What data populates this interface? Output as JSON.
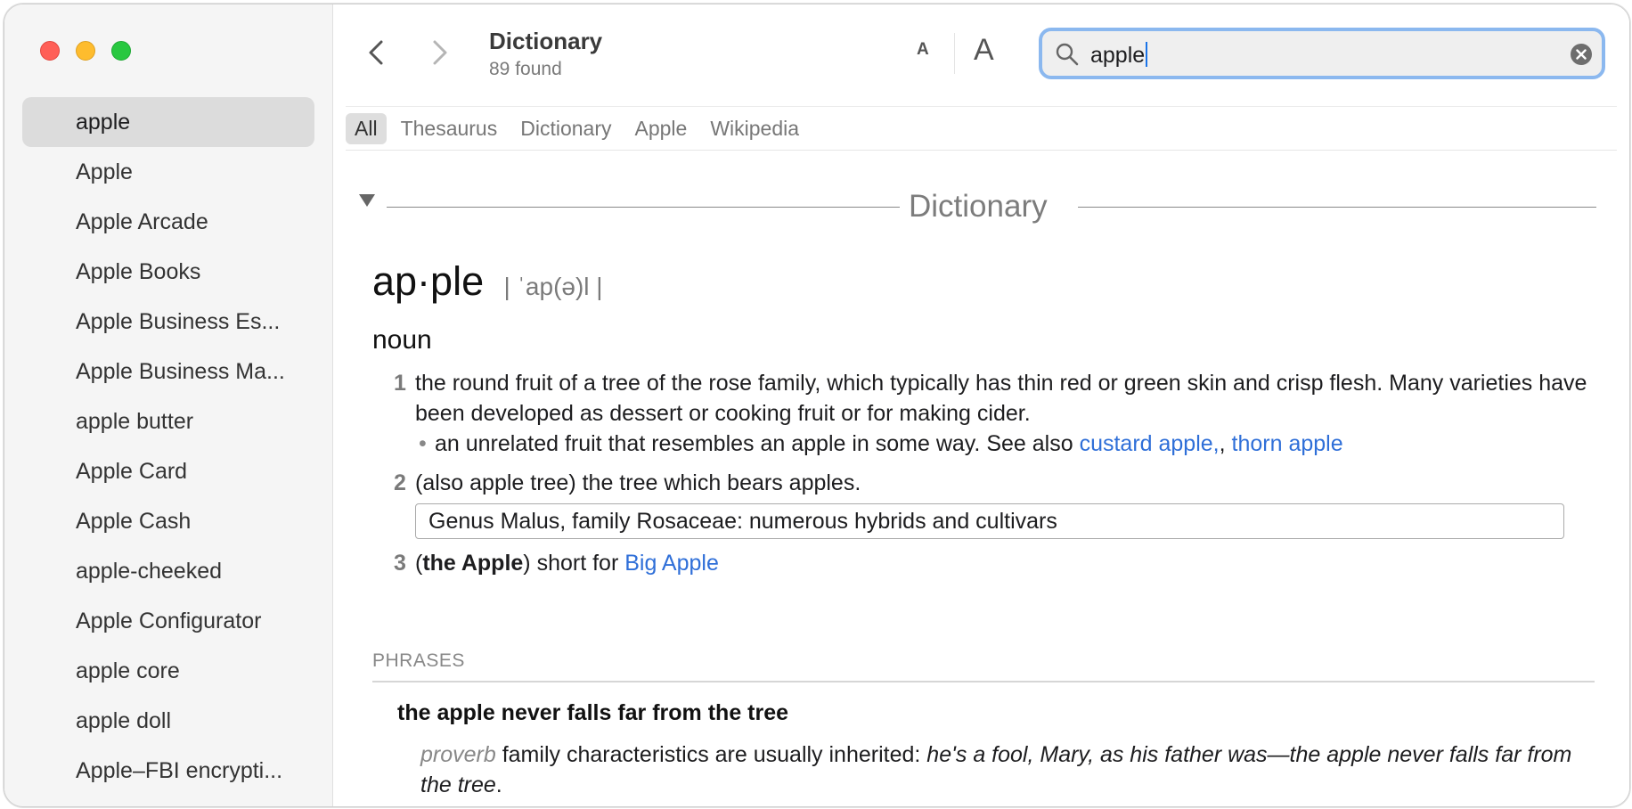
{
  "sidebar": {
    "items": [
      {
        "label": "apple",
        "selected": true
      },
      {
        "label": "Apple"
      },
      {
        "label": "Apple Arcade"
      },
      {
        "label": "Apple Books"
      },
      {
        "label": "Apple Business Es..."
      },
      {
        "label": "Apple Business Ma..."
      },
      {
        "label": "apple butter"
      },
      {
        "label": "Apple Card"
      },
      {
        "label": "Apple Cash"
      },
      {
        "label": "apple-cheeked"
      },
      {
        "label": "Apple Configurator"
      },
      {
        "label": "apple core"
      },
      {
        "label": "apple doll"
      },
      {
        "label": "Apple–FBI encrypti..."
      }
    ]
  },
  "toolbar": {
    "title": "Dictionary",
    "subtitle": "89 found",
    "font_small_label": "A",
    "font_large_label": "A",
    "search_value": "apple",
    "icons": [
      "back-chevron-icon",
      "forward-chevron-icon",
      "search-icon",
      "clear-icon"
    ]
  },
  "tabs": [
    "All",
    "Thesaurus",
    "Dictionary",
    "Apple",
    "Wikipedia"
  ],
  "active_tab": "All",
  "entry": {
    "section_title": "Dictionary",
    "headword": "ap·ple",
    "pronunciation": "| ˈap(ə)l |",
    "pos": "noun",
    "def1": {
      "num": "1",
      "text": "the round fruit of a tree of the rose family, which typically has thin red or green skin and crisp flesh. Many varieties have been developed as dessert or cooking fruit or for making cider.",
      "sub_bullet": "•",
      "sub_text": "an unrelated fruit that resembles an apple in some way. See also ",
      "link1": "custard apple,",
      "sep": ", ",
      "link2": "thorn apple"
    },
    "def2": {
      "num": "2",
      "text": "(also apple tree) the tree which bears apples.",
      "box": "Genus Malus, family Rosaceae: numerous hybrids and cultivars"
    },
    "def3": {
      "num": "3",
      "open_paren": "(",
      "bold": "the Apple",
      "close_text": ") short for ",
      "link": "Big Apple"
    },
    "phrases_label": "PHRASES",
    "phrase": "the apple never falls far from the tree",
    "phrase_label": "proverb",
    "phrase_def": " family characteristics are usually inherited: ",
    "phrase_example": "he's a fool, Mary, as his father was—the apple never falls far from the tree",
    "phrase_end": "."
  },
  "colors": {
    "link": "#2f6fd8",
    "search_focus": "#8bb8ef",
    "traffic_red": "#ff5f57",
    "traffic_yellow": "#febc2e",
    "traffic_green": "#28c840"
  }
}
